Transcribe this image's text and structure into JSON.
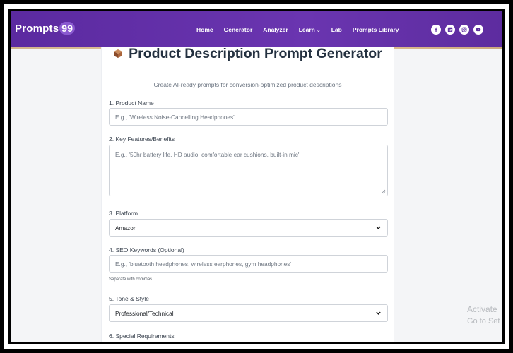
{
  "nav": {
    "logo_text": "Prompts",
    "logo_badge": "99",
    "links": [
      "Home",
      "Generator",
      "Analyzer",
      "Learn",
      "Lab",
      "Prompts Library"
    ],
    "social_icons": [
      "facebook-icon",
      "linkedin-icon",
      "instagram-icon",
      "youtube-icon"
    ]
  },
  "page": {
    "title": "Product Description Prompt Generator",
    "subtitle": "Create AI-ready prompts for conversion-optimized product descriptions"
  },
  "form": {
    "product_name": {
      "label": "1. Product Name",
      "placeholder": "E.g., 'Wireless Noise-Cancelling Headphones'"
    },
    "features": {
      "label": "2. Key Features/Benefits",
      "placeholder": "E.g., '50hr battery life, HD audio, comfortable ear cushions, built-in mic'"
    },
    "platform": {
      "label": "3. Platform",
      "value": "Amazon"
    },
    "seo": {
      "label": "4. SEO Keywords (Optional)",
      "placeholder": "E.g., 'bluetooth headphones, wireless earphones, gym headphones'",
      "hint": "Separate with commas"
    },
    "tone": {
      "label": "5. Tone & Style",
      "value": "Professional/Technical"
    },
    "special": {
      "label": "6. Special Requirements"
    }
  },
  "watermark": {
    "line1": "Activate",
    "line2": "Go to Set"
  },
  "colors": {
    "nav": "#5b2aa0",
    "accent_stripe": "#e9c58e",
    "title": "#243140"
  }
}
